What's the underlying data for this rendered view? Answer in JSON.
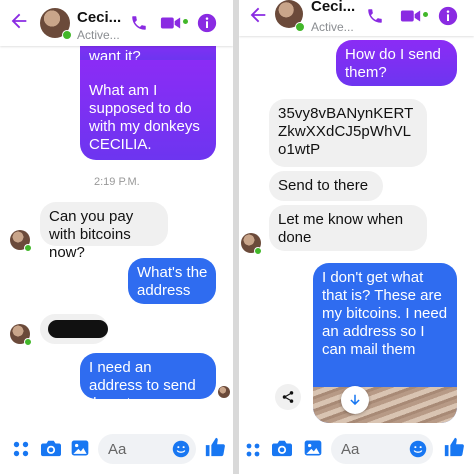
{
  "left": {
    "header": {
      "name": "Ceci...",
      "status": "Active..."
    },
    "messages": {
      "m1": "want it?",
      "m2": "What am I supposed to do with my donkeys CECILIA.",
      "time": "2:19 P.M.",
      "m3": "Can you pay with bitcoins now?",
      "m4": "What's the address",
      "m6": "I need an address to send them to"
    },
    "footer": {
      "placeholder": "Aa"
    }
  },
  "right": {
    "header": {
      "name": "Ceci...",
      "status": "Active..."
    },
    "messages": {
      "r1": "How do I send them?",
      "r2": "35vy8vBANynKERT ZkwXXdCJ5pWhVL o1wtP",
      "r3": "Send to there",
      "r4": "Let me know when done",
      "r5": "I don't get what that is? These are my bitcoins. I need an address so I can mail them"
    },
    "footer": {
      "placeholder": "Aa"
    }
  },
  "colors": {
    "accent": "#8a2be2",
    "sent_blue": "#2f6cf0",
    "sent_purple": "#7b2ff7",
    "received": "#f0f0f0",
    "online": "#42b72a",
    "icon_blue": "#1877f2"
  },
  "icons": [
    "back-arrow-icon",
    "phone-icon",
    "video-icon",
    "info-icon",
    "apps-icon",
    "camera-icon",
    "image-icon",
    "emoji-icon",
    "like-icon",
    "share-icon",
    "scroll-down-icon"
  ]
}
